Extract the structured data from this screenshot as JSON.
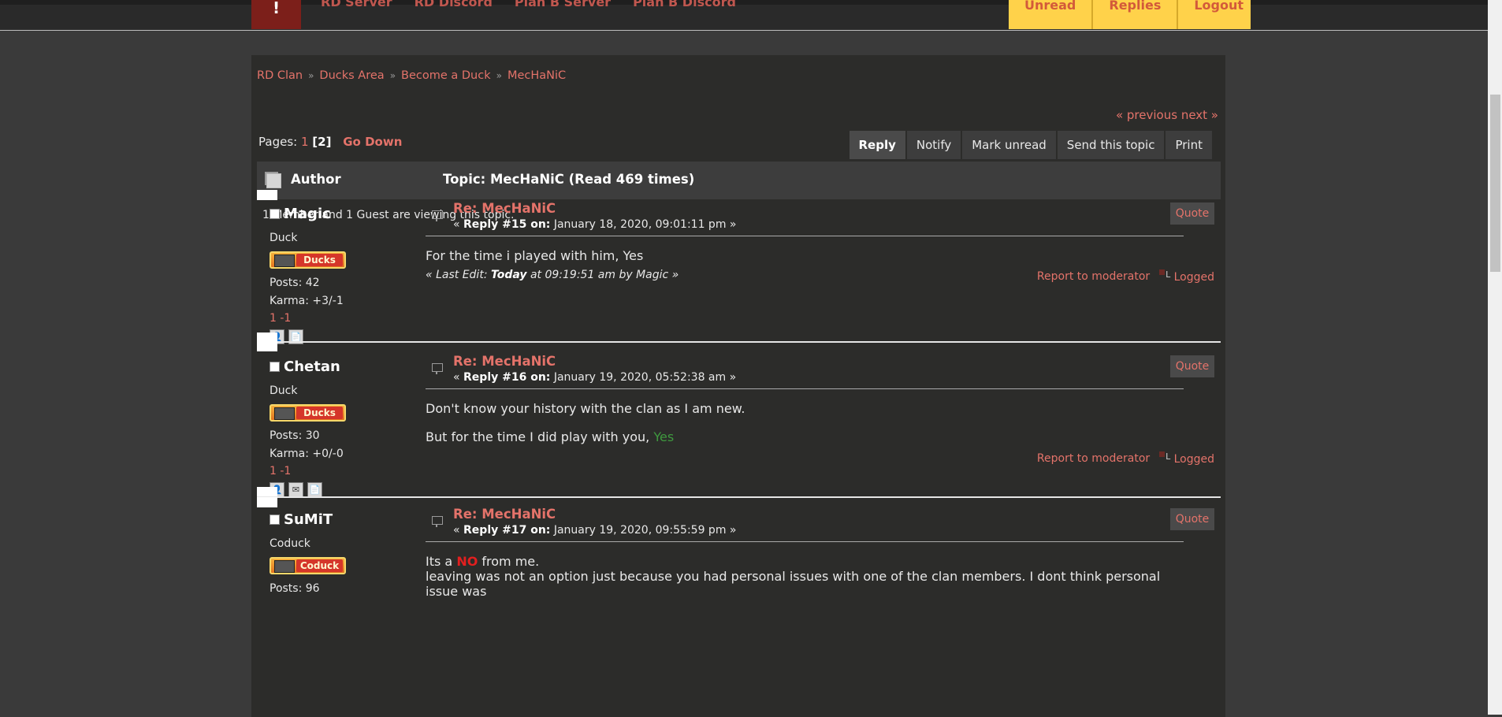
{
  "topbar": {
    "logo_text": "!",
    "nav": [
      "RD Server",
      "RD Discord",
      "Plan B Server",
      "Plan B Discord"
    ],
    "user_tabs": [
      "Unread",
      "Replies",
      "Logout"
    ]
  },
  "breadcrumb": [
    "RD Clan",
    "Ducks Area",
    "Become a Duck",
    "MecHaNiC"
  ],
  "prevnext": "« previous next »",
  "pages": {
    "label": "Pages:",
    "link": "1",
    "current": "[2]",
    "go_down": "Go Down"
  },
  "actions": [
    "Reply",
    "Notify",
    "Mark unread",
    "Send this topic",
    "Print"
  ],
  "topic": {
    "author_label": "Author",
    "title": "Topic: MecHaNiC  (Read 469 times)"
  },
  "viewing": "1 Member and 1 Guest are viewing this topic.",
  "posts": [
    {
      "poster": "Magic",
      "rank": "Duck",
      "badge": "Ducks",
      "posts": "Posts: 42",
      "karma": "Karma: +3/-1",
      "rating": "1 -1",
      "subject": "Re: MecHaNiC",
      "meta_prefix": "« ",
      "meta_reply": "Reply #15 on:",
      "meta_date": " January 18, 2020, 09:01:11 pm »",
      "body": "For the time i played with him, Yes",
      "edit_prefix": "« Last Edit: ",
      "edit_bold": "Today",
      "edit_rest": " at 09:19:51 am by Magic »",
      "quote": "Quote",
      "report": "Report to moderator",
      "logged": "Logged"
    },
    {
      "poster": "Chetan",
      "rank": "Duck",
      "badge": "Ducks",
      "posts": "Posts: 30",
      "karma": "Karma: +0/-0",
      "rating": "1 -1",
      "subject": "Re: MecHaNiC",
      "meta_prefix": "« ",
      "meta_reply": "Reply #16 on:",
      "meta_date": " January 19, 2020, 05:52:38 am »",
      "body_line1": "Don't know your history with the clan as I am new.",
      "body_line2": "But for the time I did play with you, ",
      "body_yes": "Yes",
      "quote": "Quote",
      "report": "Report to moderator",
      "logged": "Logged"
    },
    {
      "poster": "SuMiT",
      "rank": "Coduck",
      "badge": "Coduck",
      "posts": "Posts: 96",
      "subject": "Re: MecHaNiC",
      "meta_prefix": "« ",
      "meta_reply": "Reply #17 on:",
      "meta_date": " January 19, 2020, 09:55:59 pm »",
      "body_a": "Its a ",
      "body_no": "NO",
      "body_b": " from me.",
      "body_line2": "leaving was not an option just because you had personal issues with one of the clan members. I dont think personal issue was",
      "quote": "Quote"
    }
  ],
  "colors": {
    "link": "#e4736a",
    "accent_tab": "#ffd24a",
    "logo": "#7c1f1a",
    "yes": "#3f9a3f",
    "no": "#e21f1f"
  }
}
